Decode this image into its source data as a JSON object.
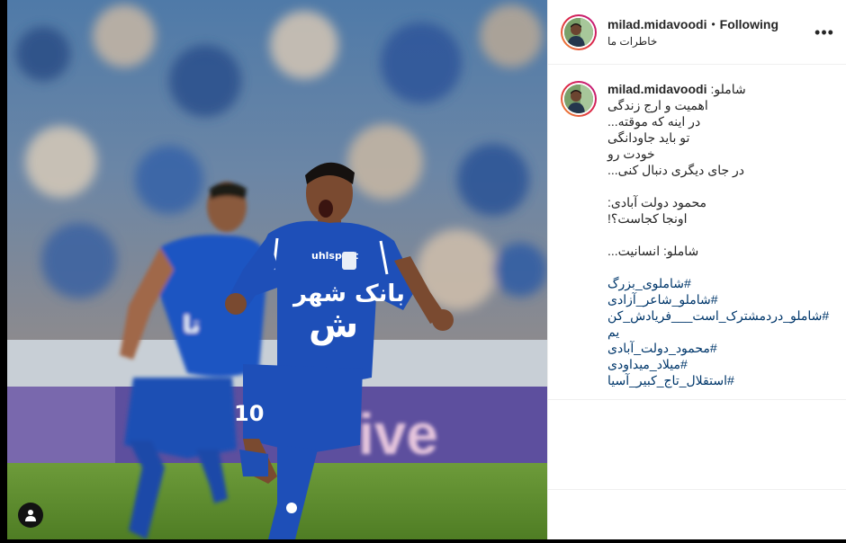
{
  "post": {
    "media": {
      "description_icon": "photo",
      "user_tag_icon": "user-tag-icon"
    },
    "header": {
      "username": "milad.midavoodi",
      "separator": "•",
      "follow_status": "Following",
      "location": "خاطرات ما",
      "more_icon": "more-options-icon",
      "more_glyph": "•••"
    },
    "caption": {
      "username": "milad.midavoodi",
      "first_line": "شاملو:",
      "lines": [
        "اهمیت و ارج زندگی",
        "در اینه که موقته...",
        "تو باید جاودانگی",
        "خودت رو",
        "در جای دیگری دنبال کنی...",
        "",
        "محمود دولت آبادی:",
        "اونجا کجاست؟!",
        "",
        "شاملو: انسانیت..."
      ],
      "hashtags": [
        "#شاملوی_بزرگ",
        "#شاملو_شاعر_آزادی",
        "#شاملو_دردمشترک_است___فریادش_کن",
        "یم",
        "#محمود_دولت_آبادی",
        "#میلاد_میداودی",
        "#استقلال_تاج_کبیر_آسیا"
      ]
    },
    "colors": {
      "link": "#00376b",
      "text": "#262626",
      "border": "#efefef",
      "kit_blue": "#1e4fb8"
    }
  }
}
